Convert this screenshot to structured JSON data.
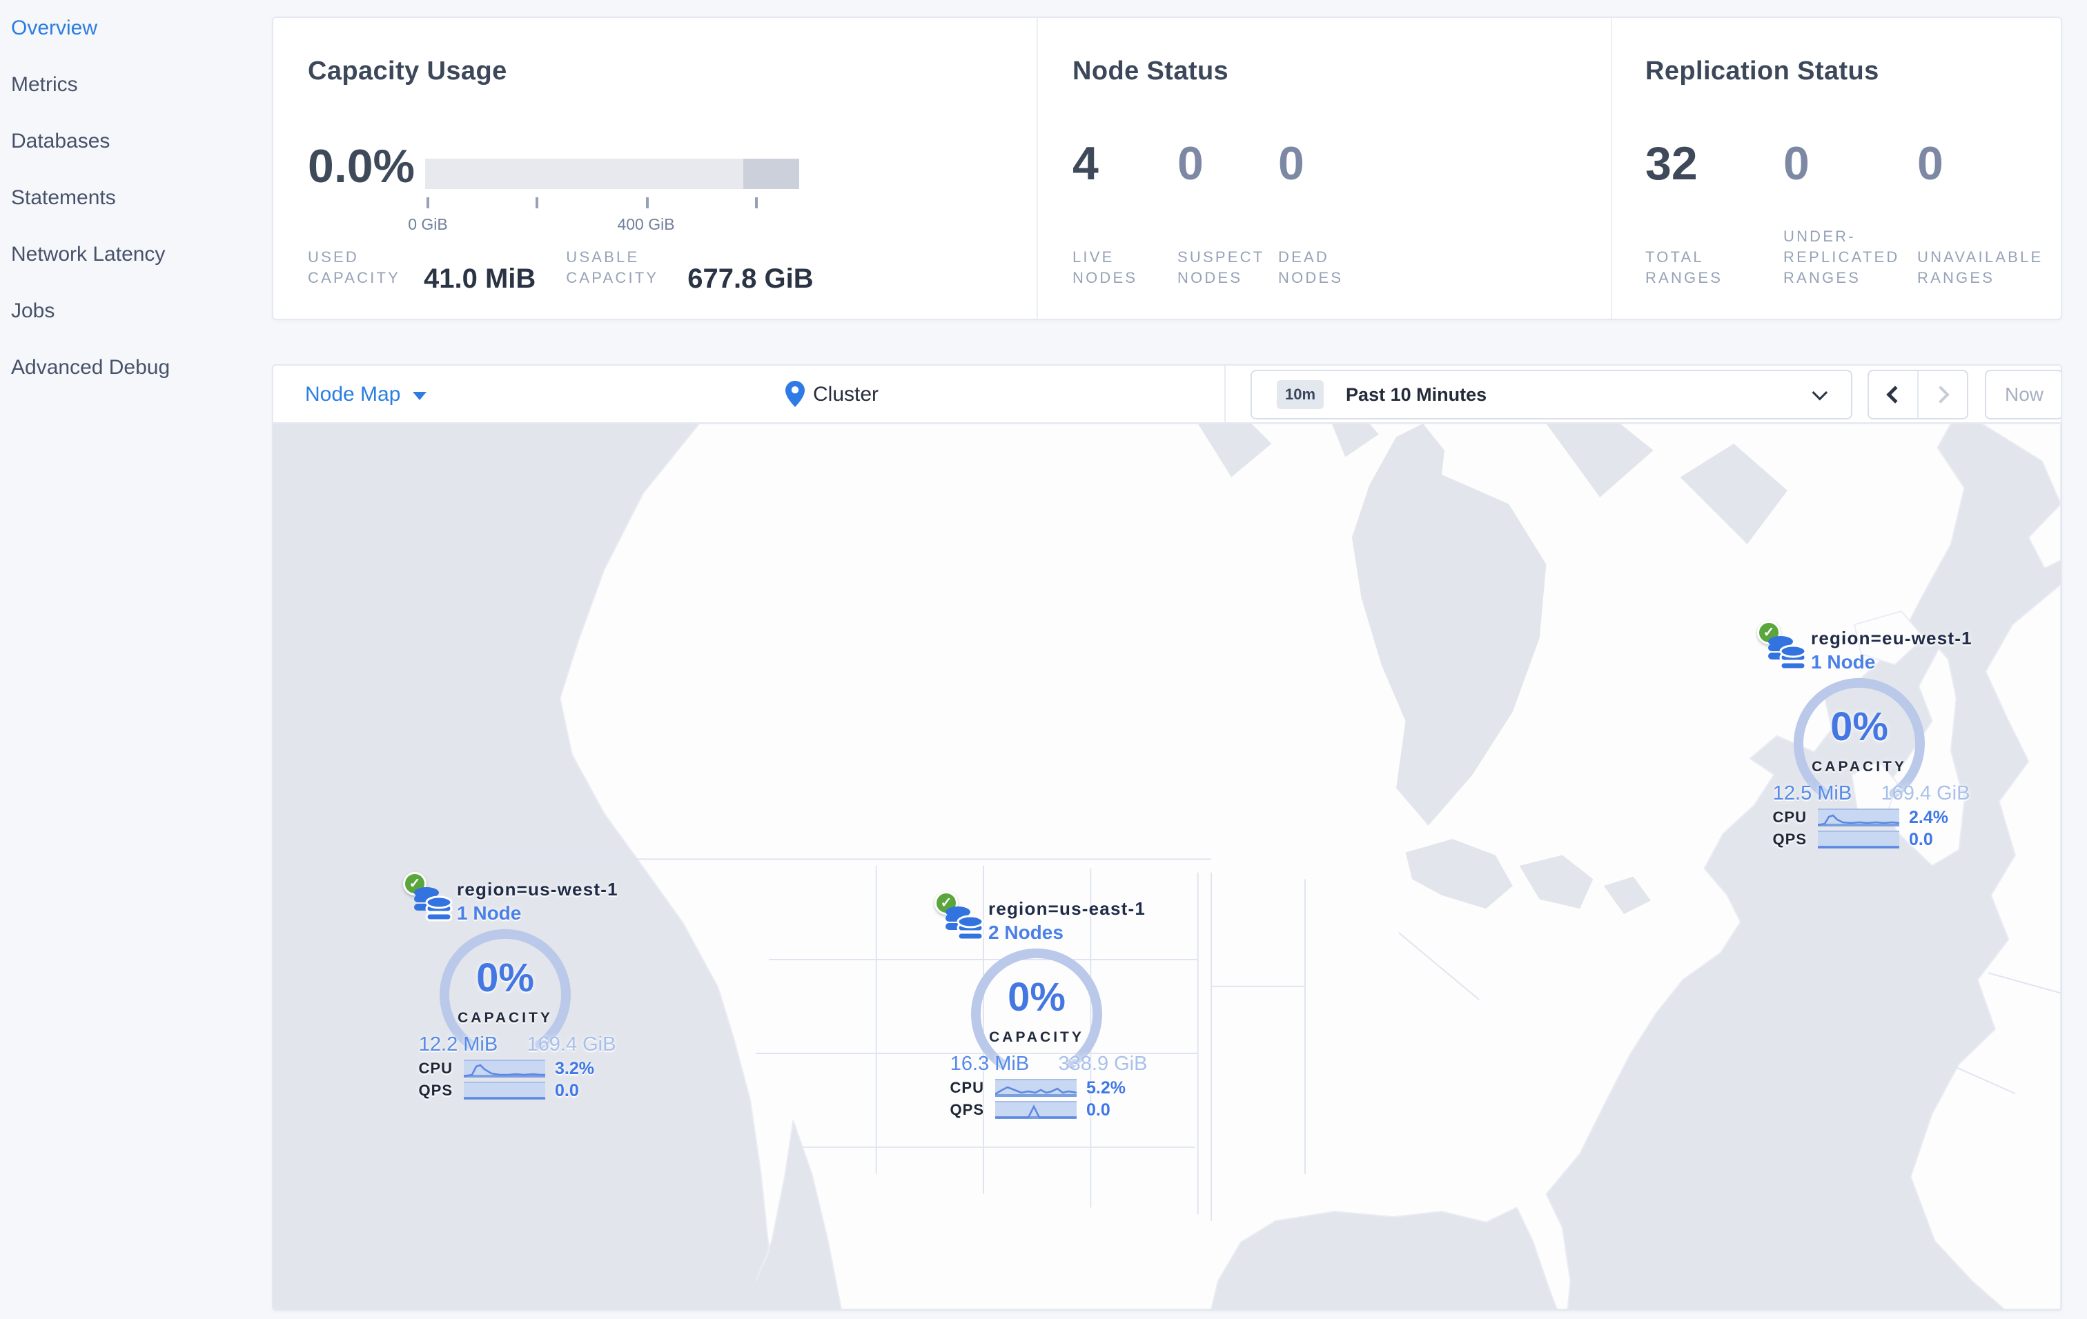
{
  "colors": {
    "accent_blue": "#2b7de1",
    "node_blue": "#4a80e8",
    "gauge_blue": "#bac9ea",
    "title_dark": "#3c4759",
    "muted_value": "#7d89a4",
    "label_gray": "#97a2b8",
    "ocean": "#e2e5eb",
    "land": "#fdfdfe",
    "check_green": "#5aa63c",
    "bar_light": "#e7e9ee",
    "bar_dark": "#cbd0da"
  },
  "sidebar": {
    "items": [
      {
        "label": "Overview",
        "active": true
      },
      {
        "label": "Metrics",
        "active": false
      },
      {
        "label": "Databases",
        "active": false
      },
      {
        "label": "Statements",
        "active": false
      },
      {
        "label": "Network Latency",
        "active": false
      },
      {
        "label": "Jobs",
        "active": false
      },
      {
        "label": "Advanced Debug",
        "active": false
      }
    ]
  },
  "summary": {
    "capacity": {
      "title": "Capacity Usage",
      "percent": "0.0%",
      "tick_labels": [
        "0 GiB",
        "400 GiB"
      ],
      "stats": [
        {
          "label": "USED CAPACITY",
          "value": "41.0 MiB"
        },
        {
          "label": "USABLE CAPACITY",
          "value": "677.8 GiB"
        }
      ]
    },
    "nodes": {
      "title": "Node Status",
      "stats": [
        {
          "value": "4",
          "label": "LIVE NODES"
        },
        {
          "value": "0",
          "label": "SUSPECT NODES"
        },
        {
          "value": "0",
          "label": "DEAD NODES"
        }
      ]
    },
    "replication": {
      "title": "Replication Status",
      "stats": [
        {
          "value": "32",
          "label": "TOTAL RANGES"
        },
        {
          "value": "0",
          "label": "UNDER-REPLICATED RANGES"
        },
        {
          "value": "0",
          "label": "UNAVAILABLE RANGES"
        }
      ]
    }
  },
  "toolbar": {
    "view_selector": "Node Map",
    "breadcrumb": "Cluster",
    "time_badge": "10m",
    "time_label": "Past 10 Minutes",
    "now_label": "Now"
  },
  "map": {
    "regions": [
      {
        "name": "region=us-west-1",
        "nodes_label": "1 Node",
        "capacity_percent": "0%",
        "capacity_label": "CAPACITY",
        "used": "12.2 MiB",
        "usable": "169.4 GiB",
        "cpu_label": "CPU",
        "cpu_value": "3.2%",
        "qps_label": "QPS",
        "qps_value": "0.0"
      },
      {
        "name": "region=us-east-1",
        "nodes_label": "2 Nodes",
        "capacity_percent": "0%",
        "capacity_label": "CAPACITY",
        "used": "16.3 MiB",
        "usable": "338.9 GiB",
        "cpu_label": "CPU",
        "cpu_value": "5.2%",
        "qps_label": "QPS",
        "qps_value": "0.0"
      },
      {
        "name": "region=eu-west-1",
        "nodes_label": "1 Node",
        "capacity_percent": "0%",
        "capacity_label": "CAPACITY",
        "used": "12.5 MiB",
        "usable": "169.4 GiB",
        "cpu_label": "CPU",
        "cpu_value": "2.4%",
        "qps_label": "QPS",
        "qps_value": "0.0"
      }
    ]
  }
}
